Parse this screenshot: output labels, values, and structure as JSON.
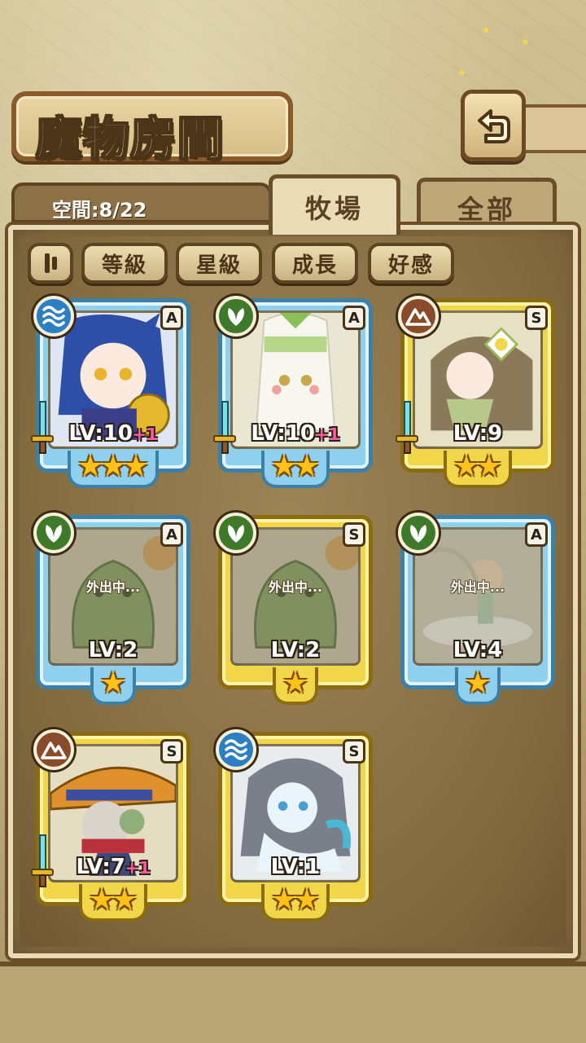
{
  "header": {
    "title": "魔物房間",
    "back_icon": "return-arrow-icon"
  },
  "status": {
    "space_label": "空間:8/22"
  },
  "tabs": [
    {
      "label": "牧場",
      "active": true
    },
    {
      "label": "全部",
      "active": false
    }
  ],
  "sort_filters": [
    {
      "label": "等級"
    },
    {
      "label": "星級"
    },
    {
      "label": "成長"
    },
    {
      "label": "好感"
    }
  ],
  "colors": {
    "rank_A": "#8fd0ef",
    "rank_S": "#f2d64a",
    "water": "#2d7fc4",
    "plant": "#3f7a2a",
    "earth": "#8a4b2a",
    "plus_pink": "#ff5aa8"
  },
  "monsters": [
    {
      "rank": "A",
      "element": "water",
      "level": "LV:10",
      "plus": "+1",
      "stars": 3,
      "away": false,
      "equipped": true
    },
    {
      "rank": "A",
      "element": "plant",
      "level": "LV:10",
      "plus": "+1",
      "stars": 2,
      "away": false,
      "equipped": true
    },
    {
      "rank": "S",
      "element": "earth",
      "level": "LV:9",
      "plus": "",
      "stars": 2,
      "away": false,
      "equipped": true
    },
    {
      "rank": "A",
      "element": "plant",
      "level": "LV:2",
      "plus": "",
      "stars": 1,
      "away": true,
      "away_text": "外出中...",
      "equipped": false
    },
    {
      "rank": "S",
      "element": "plant",
      "level": "LV:2",
      "plus": "",
      "stars": 1,
      "away": true,
      "away_text": "外出中...",
      "equipped": false
    },
    {
      "rank": "A",
      "element": "plant",
      "level": "LV:4",
      "plus": "",
      "stars": 1,
      "away": true,
      "away_text": "外出中...",
      "equipped": false
    },
    {
      "rank": "S",
      "element": "earth",
      "level": "LV:7",
      "plus": "+1",
      "stars": 2,
      "away": false,
      "equipped": true
    },
    {
      "rank": "S",
      "element": "water",
      "level": "LV:1",
      "plus": "",
      "stars": 2,
      "away": false,
      "equipped": false
    }
  ]
}
